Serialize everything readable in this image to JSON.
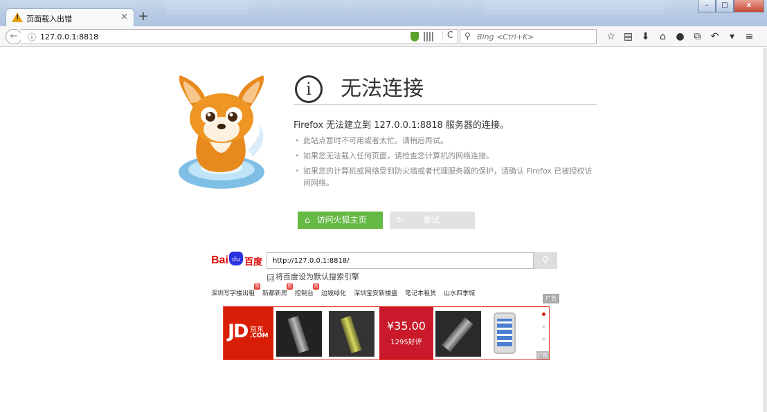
{
  "window": {
    "tab_title": "页面载入出错",
    "tab_close": "×",
    "new_tab": "+",
    "min": "–",
    "max": "□",
    "close": "x"
  },
  "nav": {
    "back": "←",
    "url_scheme_info": "ⓘ",
    "url": "127.0.0.1:8818",
    "reload": "C",
    "search_placeholder": "Bing <Ctrl+K>",
    "tools": [
      "☆",
      "▤",
      "⬇",
      "⌂",
      "●",
      "⧉",
      "↶",
      "▾",
      "≡"
    ]
  },
  "error": {
    "icon": "i",
    "title": "无法连接",
    "description": "Firefox 无法建立到 127.0.0.1:8818 服务器的连接。",
    "hints": [
      "此站点暂时不可用或者太忙。请稍后再试。",
      "如果您无法载入任何页面，请检查您计算机的网络连接。",
      "如果您的计算机或网络受到防火墙或者代理服务器的保护，请确认 Firefox 已被授权访问网络。"
    ],
    "home_icon": "⌂",
    "home_button": "访问火狐主页",
    "retry_icon": "↻",
    "retry_button": "重试"
  },
  "baidu": {
    "logo_left": "Bai",
    "logo_mid": "du",
    "logo_right": "百度",
    "search_value": "http://127.0.0.1:8818/",
    "search_icon": "⚲",
    "default_checkbox": "☑",
    "default_label": "将百度设为默认搜索引擎",
    "hot_links": [
      {
        "label": "深圳写字楼出租",
        "badge": "热"
      },
      {
        "label": "新都新房",
        "badge": "热"
      },
      {
        "label": "控制台",
        "badge": "热"
      },
      {
        "label": "边坡绿化",
        "badge": ""
      },
      {
        "label": "深圳宝安新楼盘",
        "badge": ""
      },
      {
        "label": "笔记本租赁",
        "badge": ""
      },
      {
        "label": "山水四季城",
        "badge": ""
      }
    ],
    "ad_tag": "广告"
  },
  "jd_ad": {
    "logo_jd": "JD",
    "logo_cn": "京东",
    "logo_com": ".COM",
    "price": "¥35.00",
    "reviews": "1295好评",
    "ad_tag": "广告"
  }
}
